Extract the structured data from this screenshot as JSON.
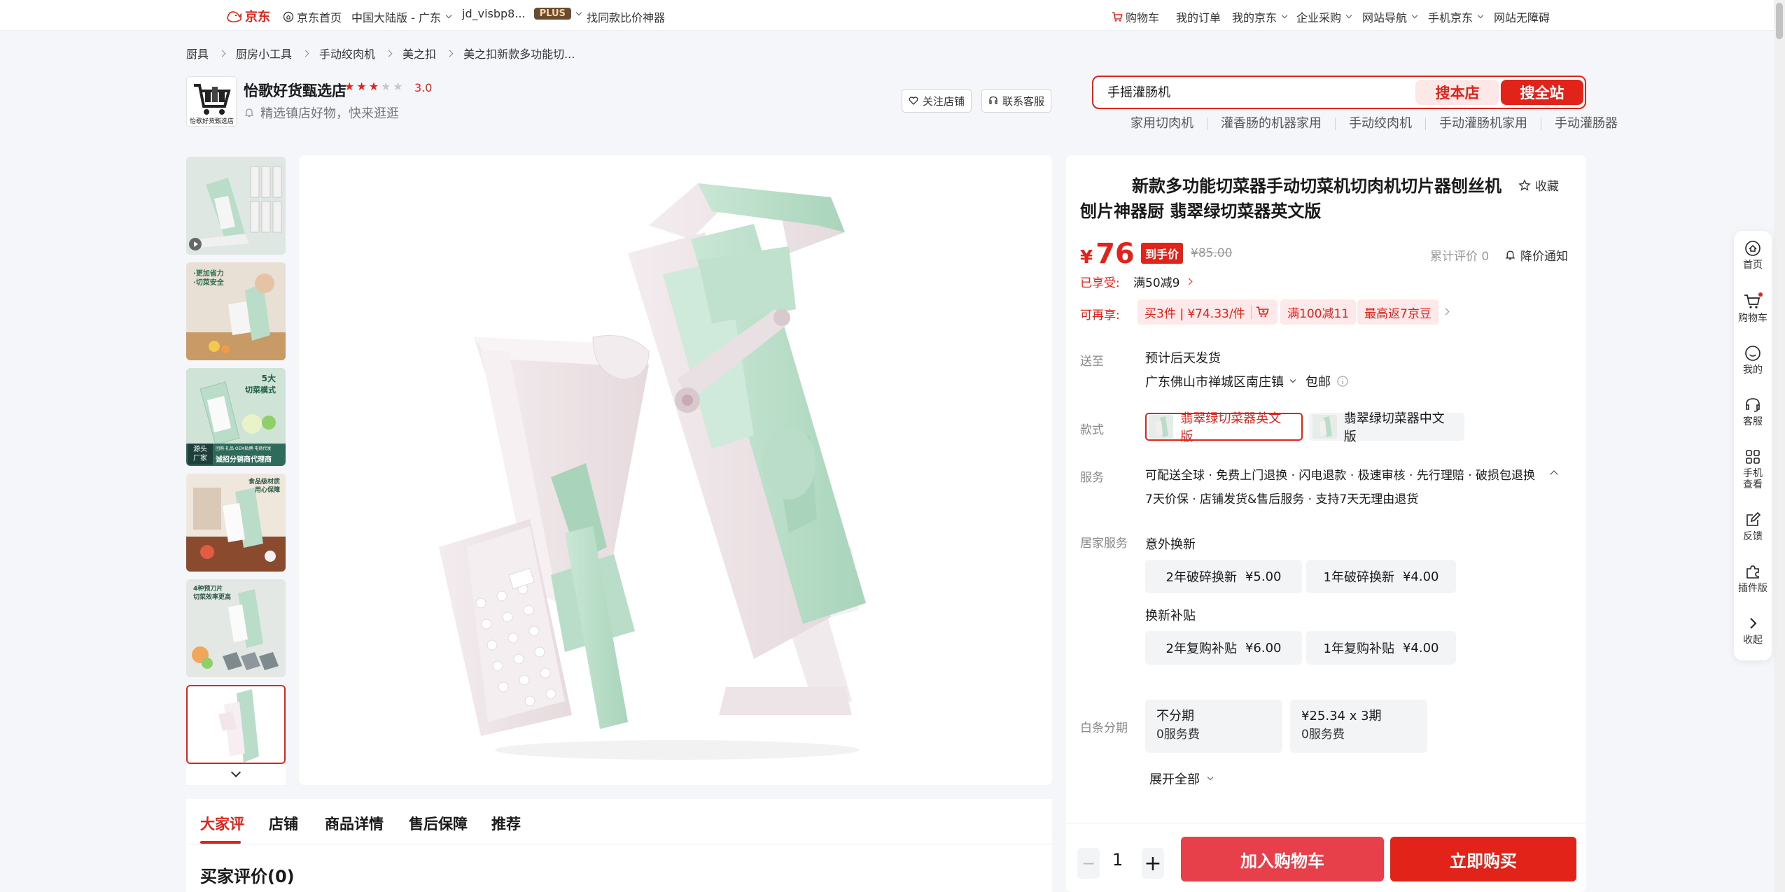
{
  "topbar": {
    "logo": "京东",
    "home": "京东首页",
    "region": "中国大陆版 - 广东",
    "user": "jd_visbp8...",
    "plus": "PLUS",
    "compare": "找同款比价神器",
    "cart": "购物车",
    "orders": "我的订单",
    "myjd": "我的京东",
    "enterprise": "企业采购",
    "sitenav": "网站导航",
    "mobile": "手机京东",
    "accessible": "网站无障碍"
  },
  "breadcrumb": [
    "厨具",
    "厨房小工具",
    "手动绞肉机",
    "美之扣",
    "美之扣新款多功能切..."
  ],
  "shop": {
    "name": "怡歌好货甄选店",
    "rating": "3.0",
    "rating_value": 3,
    "rating_max": 5,
    "slogan": "精选镇店好物，快来逛逛",
    "logo_text": "怡歌好货甄选店",
    "follow": "关注店铺",
    "service": "联系客服"
  },
  "search": {
    "value": "手摇灌肠机",
    "store_btn": "搜本店",
    "site_btn": "搜全站",
    "hot_words": [
      "家用切肉机",
      "灌香肠的机器家用",
      "手动绞肉机",
      "手动灌肠机家用",
      "手动灌肠器"
    ]
  },
  "thumbnails": [
    {
      "name": "thumb-video",
      "texts": []
    },
    {
      "name": "thumb-2",
      "texts": [
        "·更加省力",
        "·切菜安全"
      ]
    },
    {
      "name": "thumb-3",
      "texts": [
        "5大",
        "切菜模式",
        "源头",
        "厂家",
        "团购·礼品·OEM贴牌·电商代发",
        "诚招分销商代理商"
      ]
    },
    {
      "name": "thumb-4",
      "texts": [
        "食品级材质",
        "用心保障"
      ]
    },
    {
      "name": "thumb-5",
      "texts": [
        "4种预刀片",
        "切菜效率更高"
      ]
    },
    {
      "name": "thumb-6",
      "texts": []
    }
  ],
  "tabs": [
    "大家评",
    "店铺",
    "商品详情",
    "售后保障",
    "推荐"
  ],
  "reviews_title": "买家评价(0)",
  "product": {
    "title": "新款多功能切菜器手动切菜机切肉机切片器刨丝机刨片神器厨 翡翠绿切菜器英文版",
    "favorite": "收藏",
    "currency": "¥",
    "price": "76",
    "final_tag": "到手价",
    "original_price": "¥85.00",
    "review_count": "累计评价 0",
    "price_alert": "降价通知",
    "enjoyed_label": "已享受:",
    "enjoyed_value": "满50减9",
    "available_label": "可再享:",
    "promos": [
      "买3件 | ¥74.33/件",
      "满100减11",
      "最高返7京豆"
    ],
    "ship_label": "送至",
    "ship_time": "预计后天发货",
    "address": "广东佛山市禅城区南庄镇",
    "free_ship": "包邮",
    "style_label": "款式",
    "variants": [
      "翡翠绿切菜器英文版",
      "翡翠绿切菜器中文版"
    ],
    "service_label": "服务",
    "service_line1": "可配送全球 · 免费上门退换 · 闪电退款 · 极速审核 · 先行理赔 · 破损包退换",
    "service_line2": "7天价保 · 店铺发货&售后服务 · 支持7天无理由退货",
    "home_service_label": "居家服务",
    "home_sub1": "意外换新",
    "home_opts1": [
      {
        "label": "2年破碎换新",
        "price": "¥5.00"
      },
      {
        "label": "1年破碎换新",
        "price": "¥4.00"
      }
    ],
    "home_sub2": "换新补贴",
    "home_opts2": [
      {
        "label": "2年复购补贴",
        "price": "¥6.00"
      },
      {
        "label": "1年复购补贴",
        "price": "¥4.00"
      }
    ],
    "installment_label": "白条分期",
    "installments": [
      {
        "title": "不分期",
        "fee": "0服务费"
      },
      {
        "title": "¥25.34 x 3期",
        "fee": "0服务费"
      }
    ],
    "expand_all": "展开全部",
    "quantity": "1",
    "add_cart": "加入购物车",
    "buy_now": "立即购买"
  },
  "float_bar": [
    "首页",
    "购物车",
    "我的",
    "客服",
    "手机查看",
    "反馈",
    "插件版",
    "收起"
  ],
  "colors": {
    "brand_red": "#e2231a",
    "mint": "#b9ddc9",
    "background": "#f4f6fa"
  }
}
